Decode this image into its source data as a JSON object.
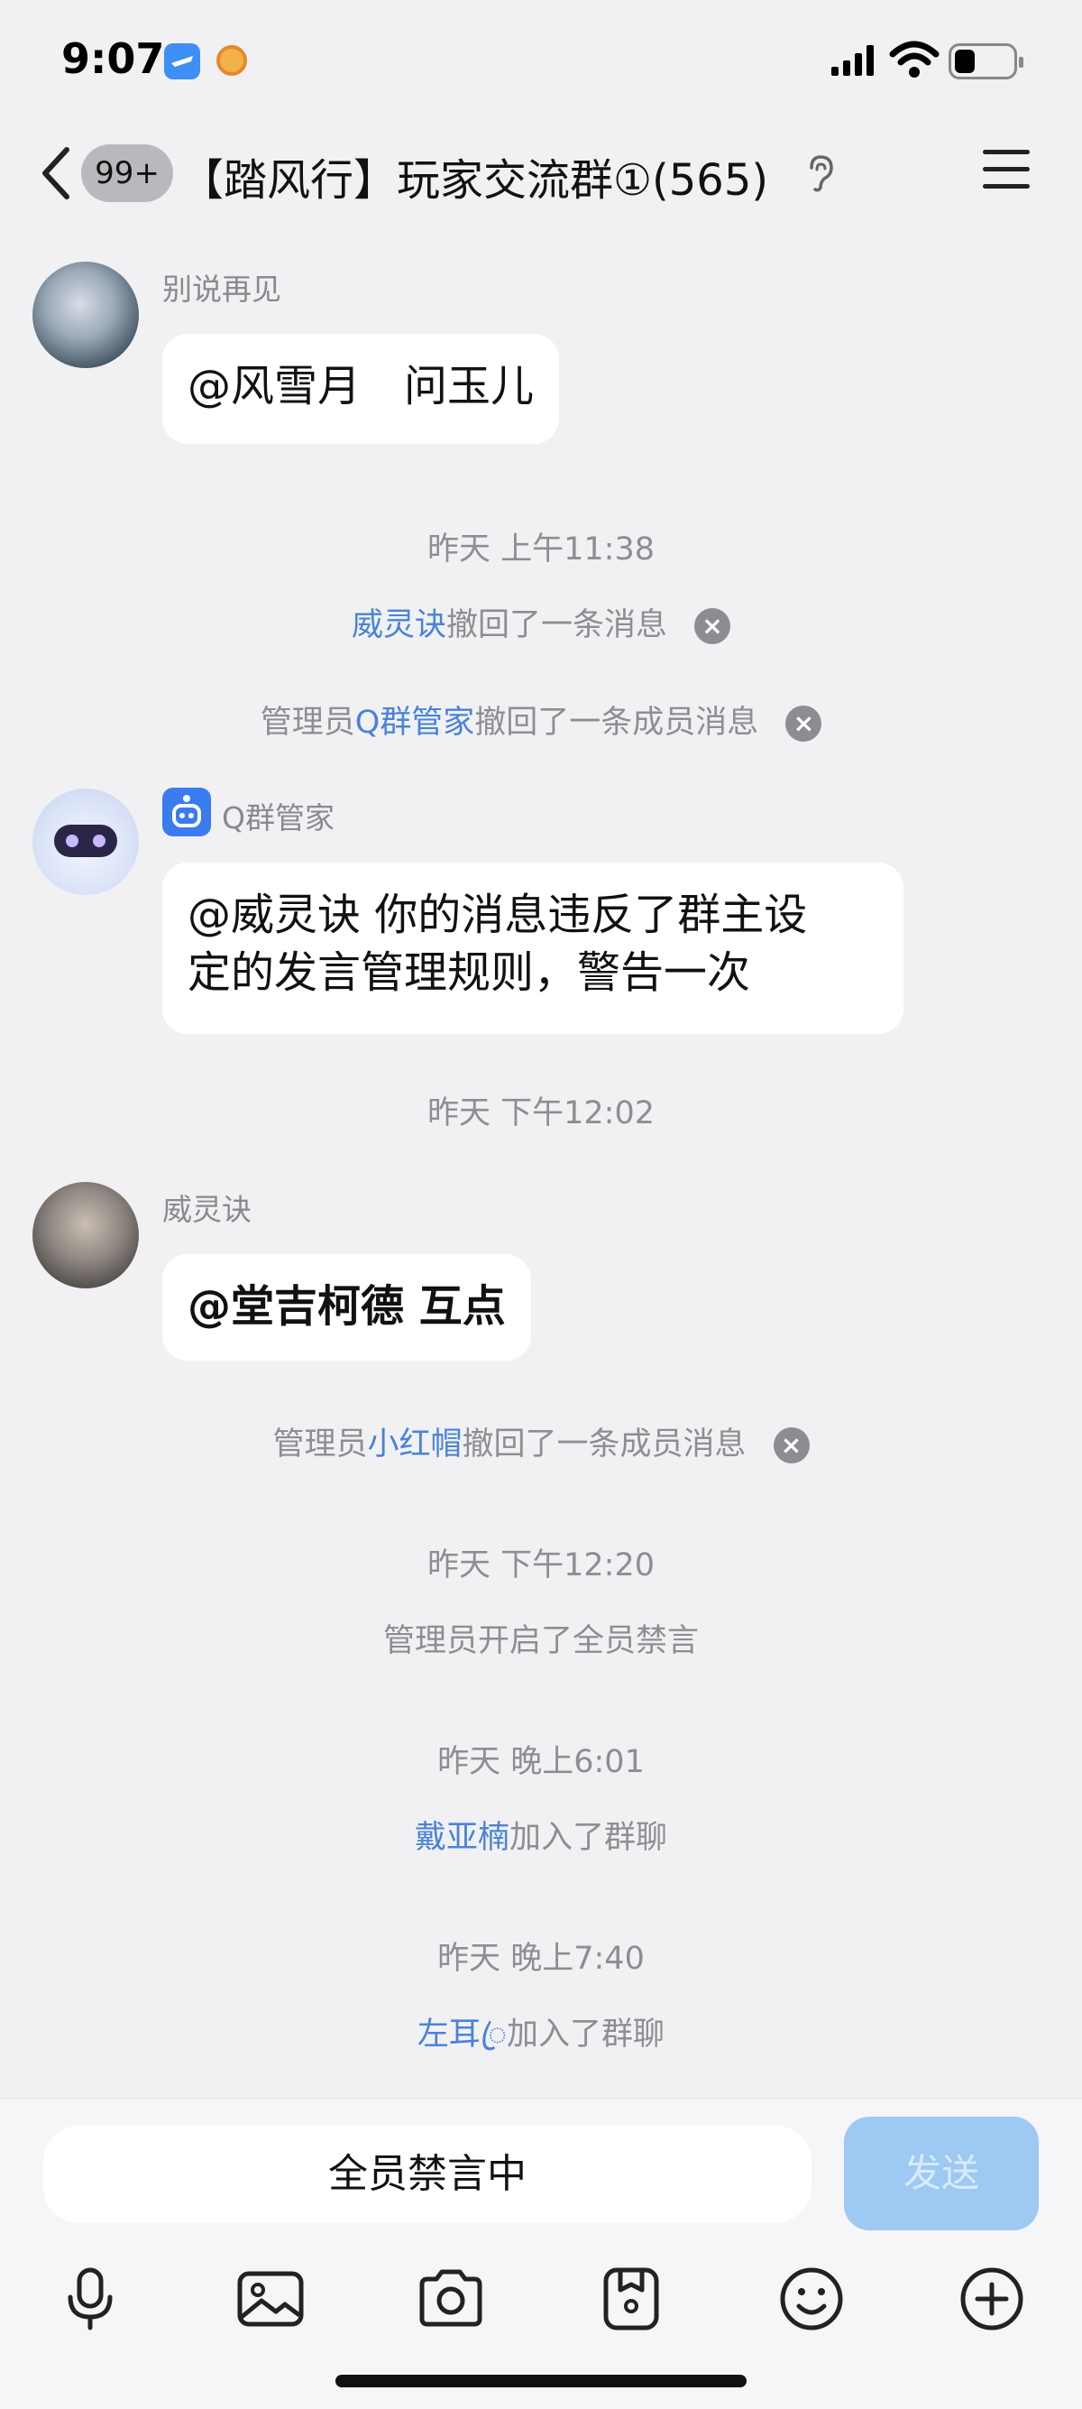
{
  "status_bar": {
    "time": "9:07"
  },
  "header": {
    "unread_badge": "99+",
    "title": "【踏风行】玩家交流群①(565)"
  },
  "messages": [
    {
      "sender": "别说再见",
      "text": "@风雪月　问玉儿"
    },
    {
      "sender": "Q群管家",
      "text_line1": "@威灵诀 你的消息违反了群主设",
      "text_line2": "定的发言管理规则，警告一次"
    },
    {
      "sender": "威灵诀",
      "text": "@堂吉柯德 互点"
    }
  ],
  "system": {
    "t1": "昨天 上午11:38",
    "recall1_name": "威灵诀",
    "recall1_text": "撤回了一条消息",
    "recall2_prefix": "管理员",
    "recall2_name": "Q群管家",
    "recall2_text": "撤回了一条成员消息",
    "t2": "昨天 下午12:02",
    "recall3_prefix": "管理员",
    "recall3_name": "小红帽",
    "recall3_text": "撤回了一条成员消息",
    "t3": "昨天 下午12:20",
    "mute_notice": "管理员开启了全员禁言",
    "t4": "昨天 晚上6:01",
    "join1_name": "戴亚楠",
    "join1_text": "加入了群聊",
    "t5": "昨天 晚上7:40",
    "join2_name": "左耳ꦿ",
    "join2_text": "加入了群聊"
  },
  "input": {
    "muted_placeholder": "全员禁言中",
    "send_label": "发送"
  },
  "toolbar": {
    "icons": [
      "microphone-icon",
      "image-icon",
      "camera-icon",
      "file-icon",
      "emoji-icon",
      "plus-icon"
    ]
  },
  "colors": {
    "background": "#f1f1f3",
    "link": "#4a83d8",
    "send_disabled": "#9dc9f2"
  }
}
